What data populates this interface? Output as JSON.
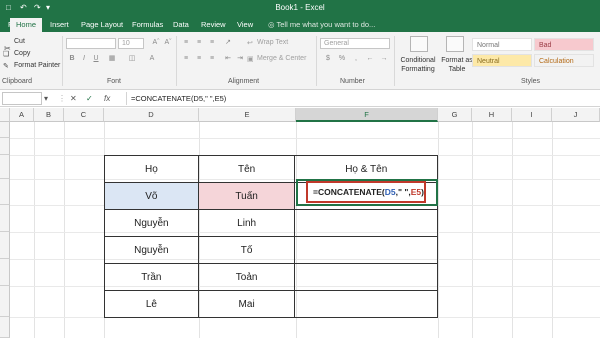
{
  "window": {
    "title": "Book1 - Excel"
  },
  "tabs": [
    "File",
    "Home",
    "Insert",
    "Page Layout",
    "Formulas",
    "Data",
    "Review",
    "View"
  ],
  "active_tab": "Home",
  "tell_me": "Tell me what you want to do...",
  "ribbon": {
    "clipboard": {
      "cut": "Cut",
      "copy": "Copy",
      "format_painter": "Format Painter",
      "label": "Clipboard"
    },
    "font": {
      "size": "10",
      "label": "Font"
    },
    "alignment": {
      "wrap_text": "Wrap Text",
      "merge_center": "Merge & Center",
      "label": "Alignment"
    },
    "number": {
      "format": "General",
      "label": "Number"
    },
    "styles": {
      "conditional_formatting": "Conditional Formatting",
      "format_as_table": "Format as Table",
      "normal": "Normal",
      "bad": "Bad",
      "neutral": "Neutral",
      "calculation": "Calculation",
      "label": "Styles"
    }
  },
  "formula_bar": {
    "name_box": "",
    "formula": "=CONCATENATE(D5,\" \",E5)"
  },
  "columns": [
    "A",
    "B",
    "C",
    "D",
    "E",
    "F",
    "G",
    "H",
    "I",
    "J"
  ],
  "selected_column": "F",
  "table": {
    "header": {
      "d": "Họ",
      "e": "Tên",
      "f": "Họ & Tên"
    },
    "rows": [
      {
        "d": "Võ",
        "e": "Tuấn",
        "f": ""
      },
      {
        "d": "Nguyễn",
        "e": "Linh",
        "f": ""
      },
      {
        "d": "Nguyễn",
        "e": "Tố",
        "f": ""
      },
      {
        "d": "Trần",
        "e": "Toản",
        "f": ""
      },
      {
        "d": "Lê",
        "e": "Mai",
        "f": ""
      }
    ]
  },
  "cell_editor": {
    "prefix": "=CONCATENATE(",
    "ref1": "D5",
    "middle": ",\" \",",
    "ref2": "E5",
    "suffix": ")"
  },
  "colors": {
    "excel_green": "#217346",
    "ref1": "#2f5fb3",
    "ref2": "#c0392b"
  }
}
